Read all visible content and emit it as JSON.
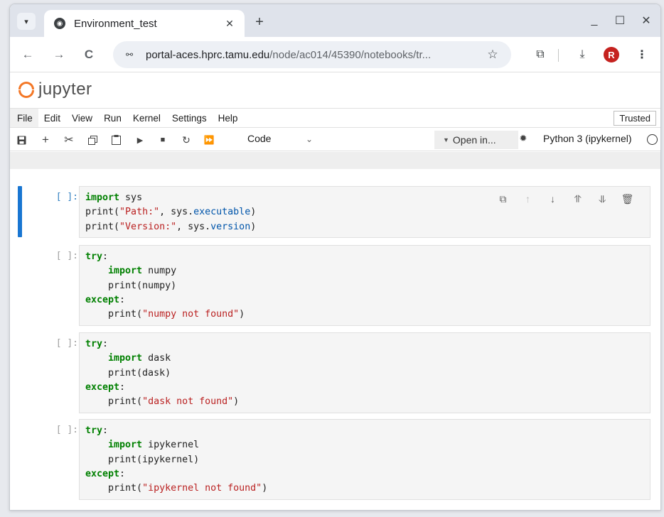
{
  "browser": {
    "tab": {
      "title": "Environment_test",
      "close": "✕"
    },
    "new_tab": "+",
    "window_controls": {
      "minimize": "_",
      "maximize": "☐",
      "close": "✕"
    },
    "nav": {
      "back": "←",
      "forward": "→",
      "reload": "C"
    },
    "url": {
      "host": "portal-aces.hprc.tamu.edu",
      "path": "/node/ac014/45390/notebooks/tr..."
    },
    "profile_initial": "R",
    "icons": [
      "tab-search-icon",
      "favicon-icon",
      "site-info-icon",
      "bookmark-star-icon",
      "extensions-icon",
      "download-icon",
      "menu-kebab-icon"
    ]
  },
  "jupyter": {
    "logo_text": "jupyter",
    "menus": [
      "File",
      "Edit",
      "View",
      "Run",
      "Kernel",
      "Settings",
      "Help"
    ],
    "trusted_label": "Trusted",
    "toolbar": {
      "cell_type": "Code",
      "open_in": "Open in...",
      "kernel_name": "Python 3 (ipykernel)"
    }
  },
  "notebook": {
    "cells": [
      {
        "prompt": "[ ]:",
        "active": true,
        "lines": [
          [
            [
              "kw",
              "import"
            ],
            [
              "txt",
              " sys"
            ]
          ],
          [
            [
              "txt",
              "print("
            ],
            [
              "str",
              "\"Path:\""
            ],
            [
              "txt",
              ", sys."
            ],
            [
              "attr",
              "executable"
            ],
            [
              "txt",
              ")"
            ]
          ],
          [
            [
              "txt",
              "print("
            ],
            [
              "str",
              "\"Version:\""
            ],
            [
              "txt",
              ", sys."
            ],
            [
              "attr",
              "version"
            ],
            [
              "txt",
              ")"
            ]
          ]
        ]
      },
      {
        "prompt": "[ ]:",
        "active": false,
        "lines": [
          [
            [
              "kw",
              "try"
            ],
            [
              "txt",
              ":"
            ]
          ],
          [
            [
              "txt",
              "    "
            ],
            [
              "kw",
              "import"
            ],
            [
              "txt",
              " numpy"
            ]
          ],
          [
            [
              "txt",
              "    print(numpy)"
            ]
          ],
          [
            [
              "kw",
              "except"
            ],
            [
              "txt",
              ":"
            ]
          ],
          [
            [
              "txt",
              "    print("
            ],
            [
              "str",
              "\"numpy not found\""
            ],
            [
              "txt",
              ")"
            ]
          ]
        ]
      },
      {
        "prompt": "[ ]:",
        "active": false,
        "lines": [
          [
            [
              "kw",
              "try"
            ],
            [
              "txt",
              ":"
            ]
          ],
          [
            [
              "txt",
              "    "
            ],
            [
              "kw",
              "import"
            ],
            [
              "txt",
              " dask"
            ]
          ],
          [
            [
              "txt",
              "    print(dask)"
            ]
          ],
          [
            [
              "kw",
              "except"
            ],
            [
              "txt",
              ":"
            ]
          ],
          [
            [
              "txt",
              "    print("
            ],
            [
              "str",
              "\"dask not found\""
            ],
            [
              "txt",
              ")"
            ]
          ]
        ]
      },
      {
        "prompt": "[ ]:",
        "active": false,
        "lines": [
          [
            [
              "kw",
              "try"
            ],
            [
              "txt",
              ":"
            ]
          ],
          [
            [
              "txt",
              "    "
            ],
            [
              "kw",
              "import"
            ],
            [
              "txt",
              " ipykernel"
            ]
          ],
          [
            [
              "txt",
              "    print(ipykernel)"
            ]
          ],
          [
            [
              "kw",
              "except"
            ],
            [
              "txt",
              ":"
            ]
          ],
          [
            [
              "txt",
              "    print("
            ],
            [
              "str",
              "\"ipykernel not found\""
            ],
            [
              "txt",
              ")"
            ]
          ]
        ]
      }
    ]
  },
  "colors": {
    "accent": "#1976d2",
    "keyword": "#008000",
    "string": "#ba2121",
    "logo": "#f37726",
    "profile": "#c5221f"
  }
}
